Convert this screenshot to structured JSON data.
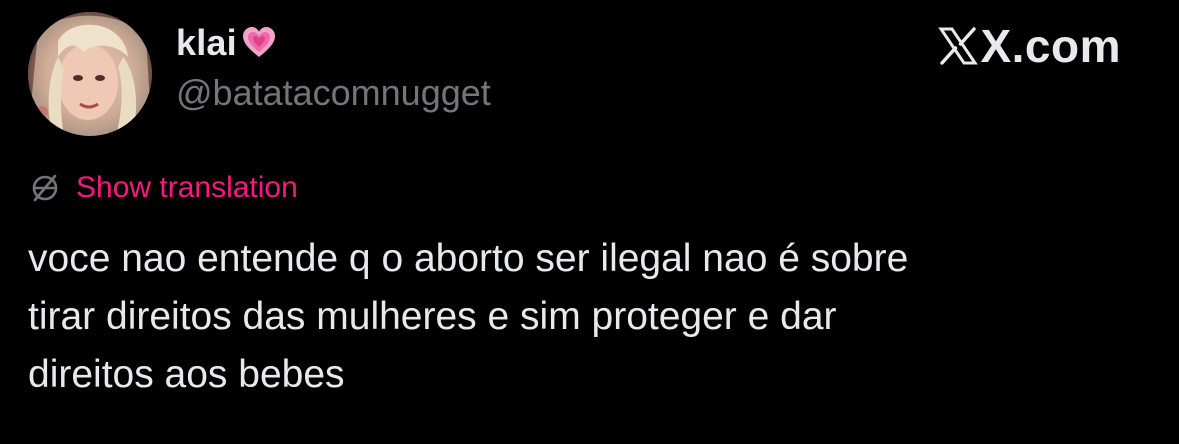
{
  "author": {
    "display_name": "klai",
    "name_emoji": "growing-heart-icon",
    "handle": "@batatacomnugget",
    "avatar": "profile-photo"
  },
  "brand": {
    "logo": "x-logo-icon",
    "text": "X.com"
  },
  "translation": {
    "icon": "globe-icon",
    "label": "Show translation"
  },
  "tweet": {
    "lines": [
      "voce nao entende q o aborto ser ilegal nao é sobre",
      "tirar direitos das mulheres e sim proteger e dar",
      "direitos aos bebes"
    ]
  },
  "colors": {
    "background": "#000000",
    "text": "#e7e9ea",
    "secondary": "#71767b",
    "link": "#f91880"
  }
}
